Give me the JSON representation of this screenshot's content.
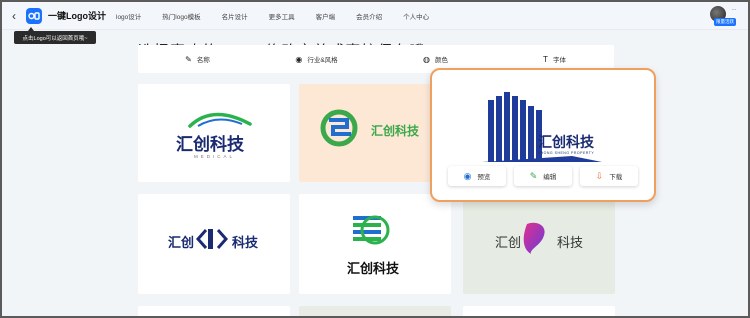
{
  "header": {
    "back_icon": "chevron-left-icon",
    "logo_badge": "logo",
    "title": "一键Logo设计",
    "nav": [
      "logo设计",
      "热门logo模板",
      "名片设计",
      "更多工具",
      "客户端",
      "会员介绍",
      "个人中心"
    ],
    "user_dots": "...",
    "vip_badge": "限量活跃"
  },
  "tooltip": "点击Logo可以返回首页哦~",
  "main": {
    "heading": "选择喜欢的LOGO修改完善或直接保存哦",
    "filters": [
      {
        "icon": "pen-icon",
        "label": "名称"
      },
      {
        "icon": "target-icon",
        "label": "行业&风格"
      },
      {
        "icon": "palette-icon",
        "label": "颜色"
      },
      {
        "icon": "text-icon",
        "label": "字体"
      }
    ]
  },
  "cards": {
    "c1": {
      "name": "汇创科技",
      "sub": "MEDICAL"
    },
    "c2": {
      "name": "汇创科技"
    },
    "c3": {
      "name": "汇创科技",
      "sub": "ZHONG SHENG PROPERTY"
    },
    "c4": {
      "left": "汇创",
      "right": "科技"
    },
    "c5": {
      "name": "汇创科技"
    },
    "c6": {
      "left": "汇创",
      "right": "科技"
    }
  },
  "hover_actions": {
    "preview": "预览",
    "edit": "编辑",
    "download": "下载"
  },
  "colors": {
    "accent": "#1a73ff",
    "hover_border": "#f0a05e",
    "brand_navy": "#1a2b72",
    "green": "#3aa84b"
  }
}
